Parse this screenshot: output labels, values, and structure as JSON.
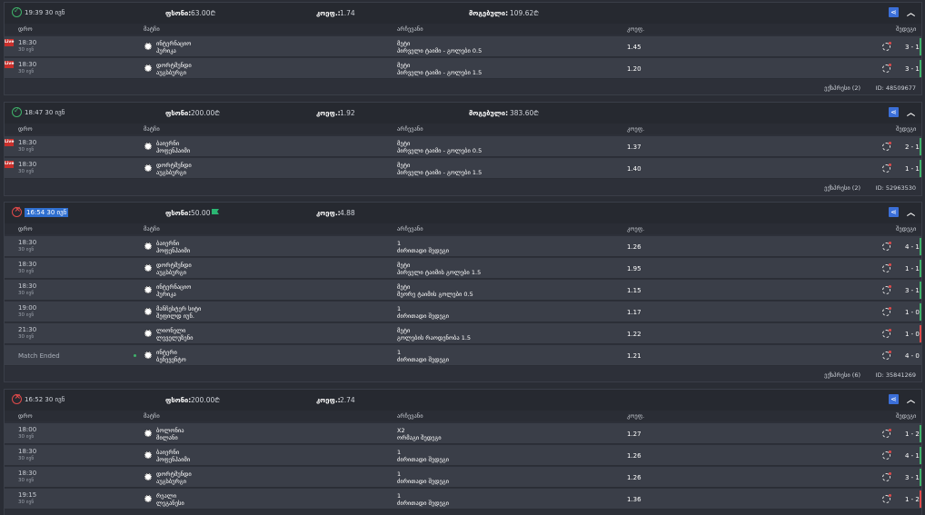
{
  "labels": {
    "stake": "ფსონი:",
    "odds": "კოეფ.:",
    "win": "მოგებული:",
    "col_date": "დრო",
    "col_match": "მატჩი",
    "col_pick": "არჩევანი",
    "col_odds": "კოეფ.",
    "col_score": "შედეგი",
    "ended": "Match Ended",
    "live": "Live"
  },
  "icons": {
    "won": "check-circle-icon",
    "lost": "x-circle-icon",
    "share": "share-icon",
    "collapse": "chevron-up-icon",
    "ball": "soccer-ball-icon",
    "stats": "stats-icon"
  },
  "colors": {
    "win": "#3fb26a",
    "loss": "#e04a4a",
    "accent": "#3b6fd8",
    "live": "#c9302c"
  },
  "bets": [
    {
      "status": "won",
      "time": "19:39 30 ივნ",
      "stake": "63.00₾",
      "odds": "1.74",
      "win": "109.62₾",
      "system": "ექსპრესი (2)",
      "id": "ID: 48509677",
      "rows": [
        {
          "live": true,
          "time": "18:30",
          "date": "30 ივნ",
          "team1": "ინტერნაციო",
          "team2": "ჰურიკა",
          "pick": "მეტი",
          "market": "პირველი ტაიმი - გოლები 0.5",
          "odd": "1.45",
          "score": "3 - 1",
          "result": "g"
        },
        {
          "live": true,
          "time": "18:30",
          "date": "30 ივნ",
          "team1": "დორტმუნდი",
          "team2": "აუგსბურგი",
          "pick": "მეტი",
          "market": "პირველი ტაიმი - გოლები 1.5",
          "odd": "1.20",
          "score": "3 - 1",
          "result": "g"
        }
      ]
    },
    {
      "status": "won",
      "time": "18:47 30 ივნ",
      "stake": "200.00₾",
      "odds": "1.92",
      "win": "383.60₾",
      "system": "ექსპრესი (2)",
      "id": "ID: 52963530",
      "rows": [
        {
          "live": true,
          "time": "18:30",
          "date": "30 ივნ",
          "team1": "ბაიერნი",
          "team2": "ჰოფენჰაიმი",
          "pick": "მეტი",
          "market": "პირველი ტაიმი - გოლები 0.5",
          "odd": "1.37",
          "score": "2 - 1",
          "result": "g"
        },
        {
          "live": true,
          "time": "18:30",
          "date": "30 ივნ",
          "team1": "დორტმუნდი",
          "team2": "აუგსბურგი",
          "pick": "მეტი",
          "market": "პირველი ტაიმი - გოლები 1.5",
          "odd": "1.40",
          "score": "1 - 1",
          "result": "g"
        }
      ]
    },
    {
      "status": "lost",
      "time": "16:54 30 ივნ",
      "stake": "50.00",
      "odds": "4.88",
      "win": "",
      "system": "ექსპრესი (6)",
      "id": "ID: 35841269",
      "rows": [
        {
          "live": false,
          "time": "18:30",
          "date": "30 ივნ",
          "team1": "ბაიერნი",
          "team2": "ჰოფენჰაიმი",
          "pick": "1",
          "market": "ძირითადი შედეგი",
          "odd": "1.26",
          "score": "4 - 1",
          "result": "g"
        },
        {
          "live": false,
          "time": "18:30",
          "date": "30 ივნ",
          "team1": "დორტმუნდი",
          "team2": "აუგსბურგი",
          "pick": "მეტი",
          "market": "პირველი ტაიმის გოლები 1.5",
          "odd": "1.95",
          "score": "1 - 1",
          "result": "g"
        },
        {
          "live": false,
          "time": "18:30",
          "date": "30 ივნ",
          "team1": "ინტერნაციო",
          "team2": "ჰურიკა",
          "pick": "მეტი",
          "market": "მეორე ტაიმის გოლები 0.5",
          "odd": "1.15",
          "score": "3 - 1",
          "result": "g"
        },
        {
          "live": false,
          "time": "19:00",
          "date": "30 ივნ",
          "team1": "მანჩესტერ სიტი",
          "team2": "შეფილდ იუნ.",
          "pick": "1",
          "market": "ძირითადი შედეგი",
          "odd": "1.17",
          "score": "1 - 0",
          "result": "g"
        },
        {
          "live": false,
          "time": "21:30",
          "date": "30 ივნ",
          "team1": "ლიონელი",
          "team2": "ლეველუზენი",
          "pick": "მეტი",
          "market": "გოლების რაოდენობა 1.5",
          "odd": "1.22",
          "score": "1 - 0",
          "result": "r"
        },
        {
          "live": false,
          "ended": true,
          "team1": "ინტერი",
          "team2": "ბენევენტო",
          "pick": "1",
          "market": "ძირითადი შედეგი",
          "odd": "1.21",
          "score": "4 - 0",
          "result": ""
        }
      ]
    },
    {
      "status": "lost",
      "time": "16:52 30 ივნ",
      "stake": "200.00₾",
      "odds": "2.74",
      "win": "",
      "system": "",
      "id": "",
      "rows": [
        {
          "live": false,
          "time": "18:00",
          "date": "30 ივნ",
          "team1": "ბოლონია",
          "team2": "მილანი",
          "pick": "X2",
          "market": "ორმაგი შედეგი",
          "odd": "1.27",
          "score": "1 - 2",
          "result": "g"
        },
        {
          "live": false,
          "time": "18:30",
          "date": "30 ივნ",
          "team1": "ბაიერნი",
          "team2": "ჰოფენჰაიმი",
          "pick": "1",
          "market": "ძირითადი შედეგი",
          "odd": "1.26",
          "score": "4 - 1",
          "result": "g"
        },
        {
          "live": false,
          "time": "18:30",
          "date": "30 ივნ",
          "team1": "დორტმუნდი",
          "team2": "აუგსბურგი",
          "pick": "1",
          "market": "ძირითადი შედეგი",
          "odd": "1.26",
          "score": "3 - 1",
          "result": "g"
        },
        {
          "live": false,
          "time": "19:15",
          "date": "30 ივნ",
          "team1": "რეალი",
          "team2": "ლეგანესი",
          "pick": "1",
          "market": "ძირითადი შედეგი",
          "odd": "1.36",
          "score": "1 - 2",
          "result": "r"
        }
      ]
    }
  ]
}
